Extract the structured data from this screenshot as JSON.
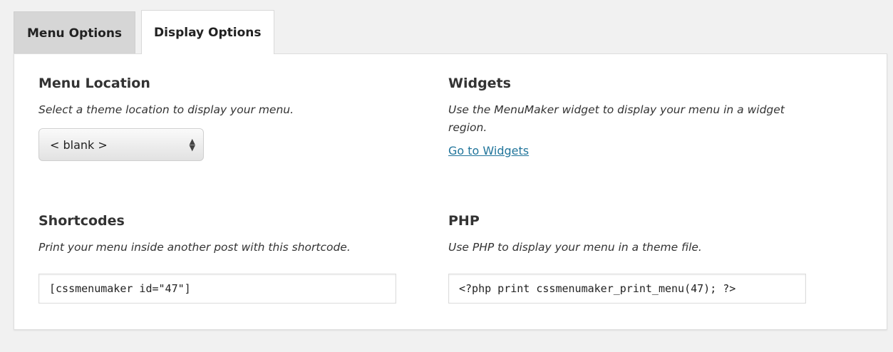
{
  "tabs": [
    {
      "label": "Menu Options",
      "active": false
    },
    {
      "label": "Display Options",
      "active": true
    }
  ],
  "menu_location": {
    "title": "Menu Location",
    "description": "Select a theme location to display your menu.",
    "select_value": "< blank >"
  },
  "widgets": {
    "title": "Widgets",
    "description": "Use the MenuMaker widget to display your menu in a widget region.",
    "link_label": "Go to Widgets"
  },
  "shortcodes": {
    "title": "Shortcodes",
    "description": "Print your menu inside another post with this shortcode.",
    "value": "[cssmenumaker id=\"47\"]"
  },
  "php": {
    "title": "PHP",
    "description": "Use PHP to display your menu in a theme file.",
    "value": "<?php print cssmenumaker_print_menu(47); ?>"
  },
  "colors": {
    "link": "#21759b",
    "tab_inactive": "#d6d6d6",
    "panel": "#ffffff",
    "page_bg": "#f1f1f1"
  }
}
